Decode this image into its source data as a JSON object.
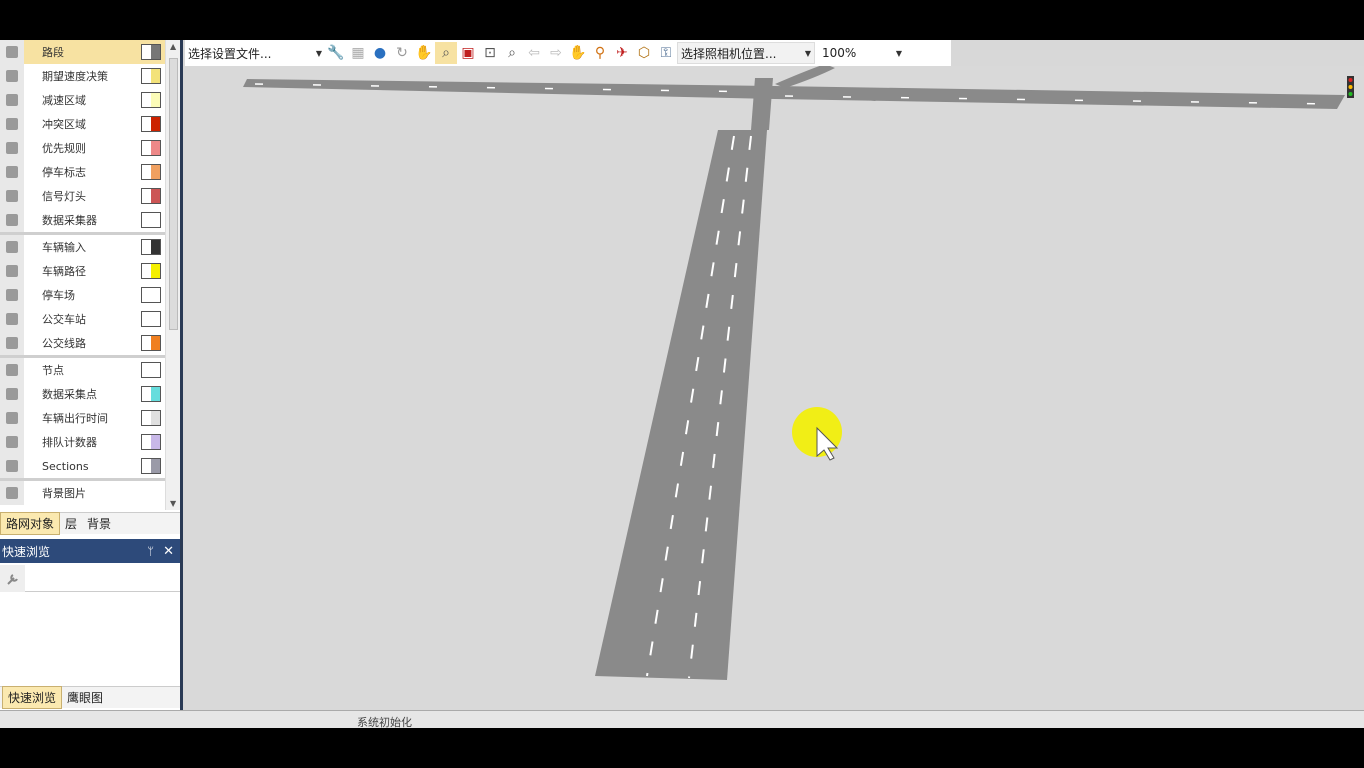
{
  "object_list": [
    {
      "label": "路段",
      "icon": "road-segment-icon",
      "swatch": "#777777",
      "selected": true
    },
    {
      "label": "期望速度决策",
      "icon": "speed-limit-icon",
      "swatch": "#f3e27a"
    },
    {
      "label": "减速区域",
      "icon": "reduce-speed-icon",
      "swatch": "#fbfbb8"
    },
    {
      "label": "冲突区域",
      "icon": "conflict-area-icon",
      "swatch": "#cc2200"
    },
    {
      "label": "优先规则",
      "icon": "priority-rule-icon",
      "swatch": "#ee8888"
    },
    {
      "label": "停车标志",
      "icon": "stop-sign-icon",
      "swatch": "#f0a060"
    },
    {
      "label": "信号灯头",
      "icon": "signal-head-icon",
      "swatch": "#cc5555"
    },
    {
      "label": "数据采集器",
      "icon": "data-collector-icon",
      "swatch": "#ffffff"
    },
    {
      "label": "车辆输入",
      "icon": "vehicle-input-icon",
      "swatch": "#333333"
    },
    {
      "label": "车辆路径",
      "icon": "vehicle-route-icon",
      "swatch": "#f5f000"
    },
    {
      "label": "停车场",
      "icon": "parking-icon",
      "swatch": "#ffffff"
    },
    {
      "label": "公交车站",
      "icon": "bus-stop-icon",
      "swatch": "#ffffff"
    },
    {
      "label": "公交线路",
      "icon": "bus-line-icon",
      "swatch": "#f07f20"
    },
    {
      "label": "节点",
      "icon": "node-icon",
      "swatch": "#ffffff"
    },
    {
      "label": "数据采集点",
      "icon": "data-point-icon",
      "swatch": "#66dddd"
    },
    {
      "label": "车辆出行时间",
      "icon": "travel-time-icon",
      "swatch": "#e0e0e0"
    },
    {
      "label": "排队计数器",
      "icon": "queue-counter-icon",
      "swatch": "#c8b8e8"
    },
    {
      "label": "Sections",
      "icon": "sections-icon",
      "swatch": "#9a9aa8"
    },
    {
      "label": "背景图片",
      "icon": "background-image-icon",
      "swatch": ""
    }
  ],
  "left_tabs": [
    "路网对象",
    "层",
    "背景"
  ],
  "quick_view": {
    "title": "快速浏览",
    "pin": "ᛘ",
    "close": "✕"
  },
  "bottom_tabs": [
    "快速浏览",
    "鹰眼图"
  ],
  "toolbar": {
    "config_file": "选择设置文件...",
    "camera_position": "选择照相机位置...",
    "zoom": "100%"
  },
  "status_text": "系统初始化"
}
